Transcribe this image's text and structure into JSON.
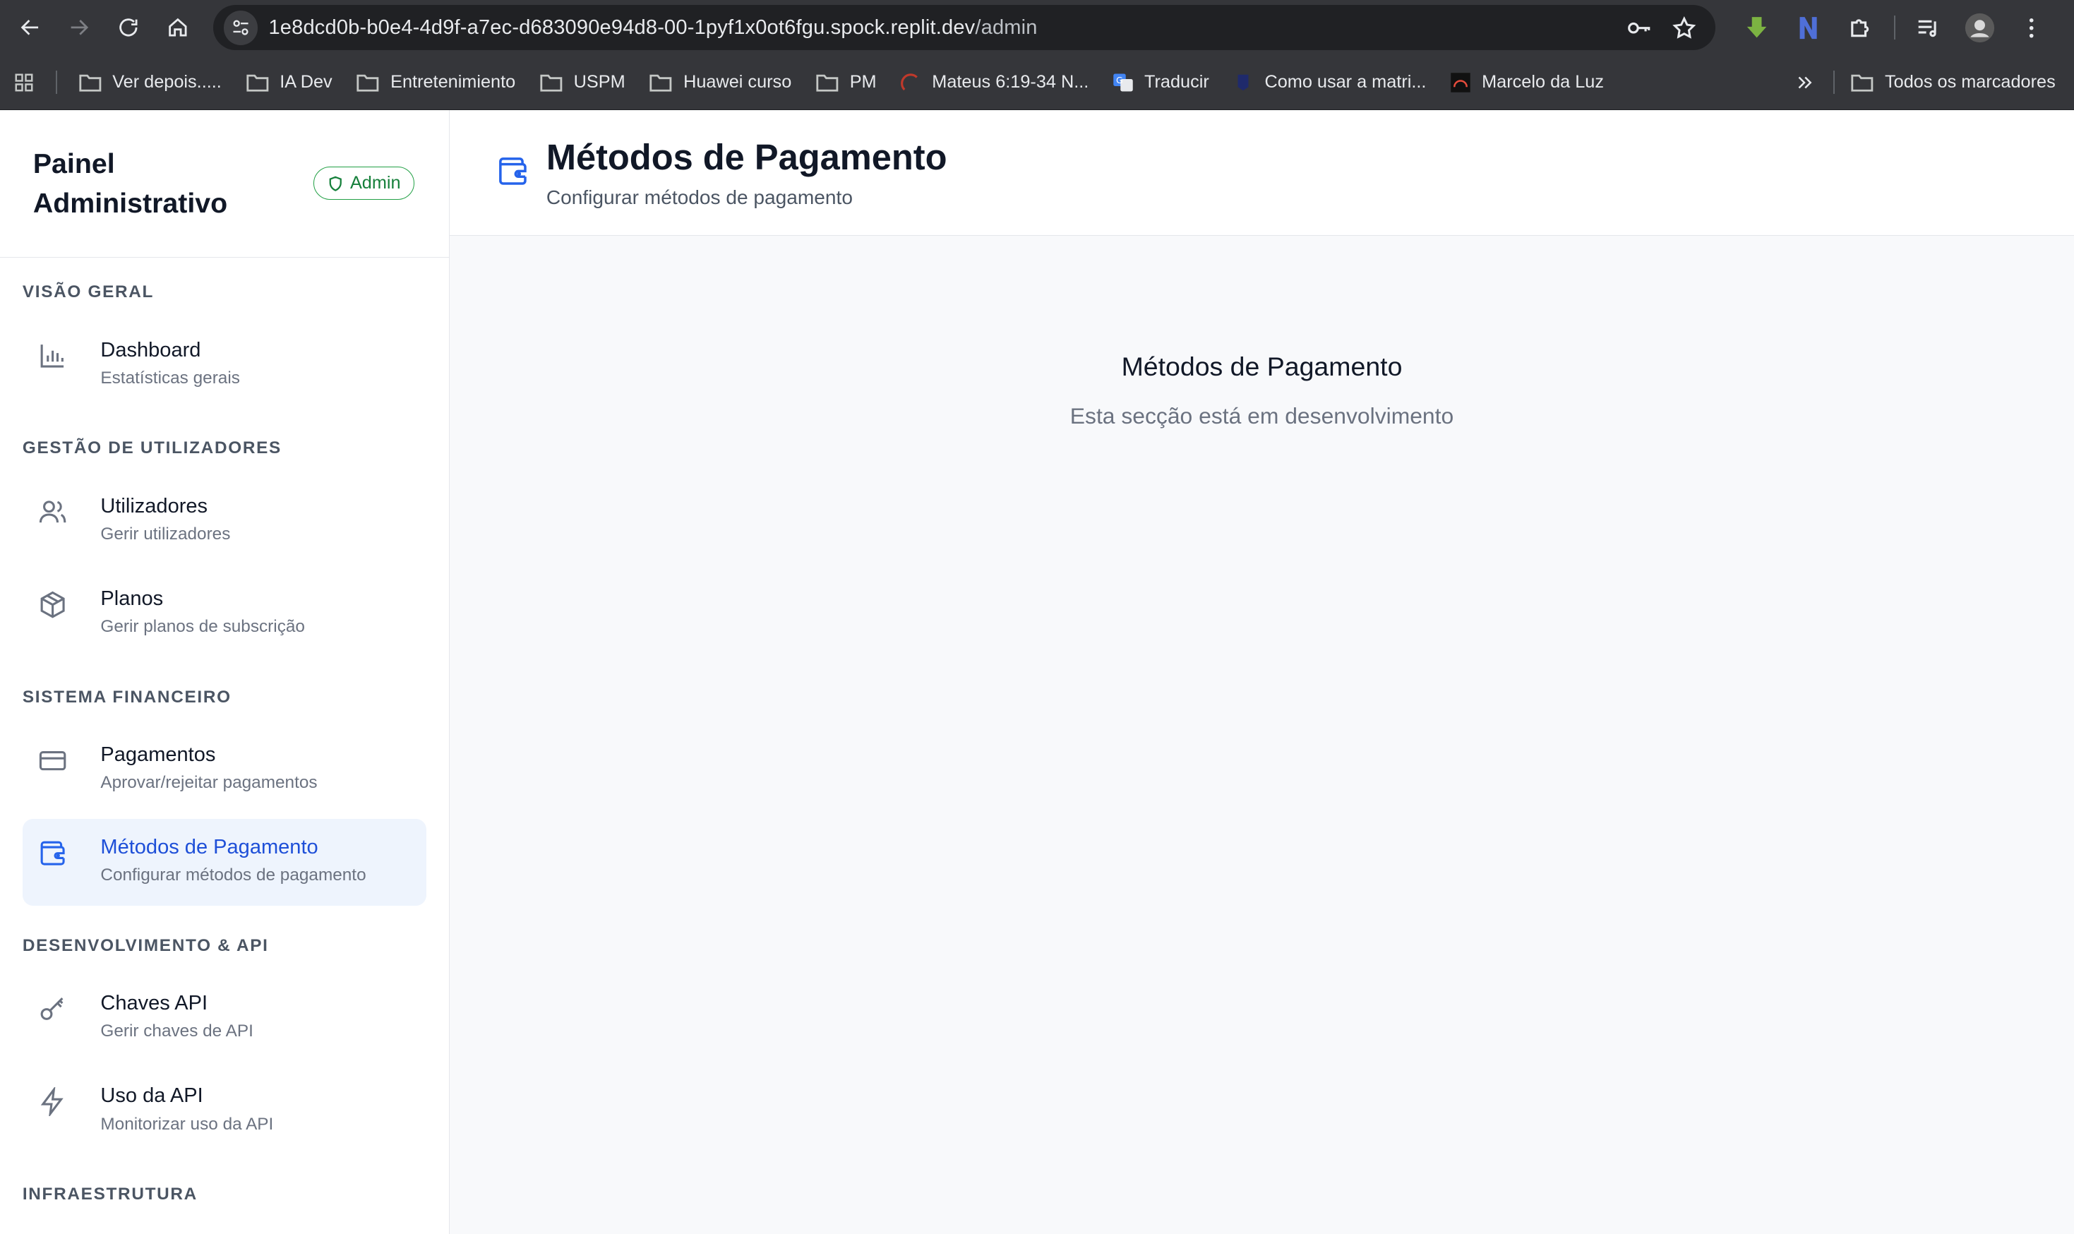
{
  "browser": {
    "url_host": "1e8dcd0b-b0e4-4d9f-a7ec-d683090e94d8-00-1pyf1x0ot6fgu.spock.replit.dev",
    "url_path": "/admin",
    "bookmarks": [
      {
        "label": "Ver depois.....",
        "icon": "folder-icon"
      },
      {
        "label": "IA Dev",
        "icon": "folder-icon"
      },
      {
        "label": "Entretenimiento",
        "icon": "folder-icon"
      },
      {
        "label": "USPM",
        "icon": "folder-icon"
      },
      {
        "label": "Huawei curso",
        "icon": "folder-icon"
      },
      {
        "label": "PM",
        "icon": "folder-icon"
      },
      {
        "label": "Mateus 6:19-34 N...",
        "icon": "site-favicon-icon"
      },
      {
        "label": "Traducir",
        "icon": "translate-favicon-icon"
      },
      {
        "label": "Como usar a matri...",
        "icon": "site-favicon-icon"
      },
      {
        "label": "Marcelo da Luz",
        "icon": "site-favicon-icon"
      }
    ],
    "all_bookmarks": "Todos os marcadores"
  },
  "sidebar": {
    "title": "Painel Administrativo",
    "badge": "Admin",
    "sections": [
      {
        "title": "VISÃO GERAL",
        "items": [
          {
            "label": "Dashboard",
            "sub": "Estatísticas gerais",
            "icon": "bar-chart-icon"
          }
        ]
      },
      {
        "title": "GESTÃO DE UTILIZADORES",
        "items": [
          {
            "label": "Utilizadores",
            "sub": "Gerir utilizadores",
            "icon": "users-icon"
          },
          {
            "label": "Planos",
            "sub": "Gerir planos de subscrição",
            "icon": "package-icon"
          }
        ]
      },
      {
        "title": "SISTEMA FINANCEIRO",
        "items": [
          {
            "label": "Pagamentos",
            "sub": "Aprovar/rejeitar pagamentos",
            "icon": "credit-card-icon"
          },
          {
            "label": "Métodos de Pagamento",
            "sub": "Configurar métodos de pagamento",
            "icon": "wallet-icon",
            "active": true
          }
        ]
      },
      {
        "title": "DESENVOLVIMENTO & API",
        "items": [
          {
            "label": "Chaves API",
            "sub": "Gerir chaves de API",
            "icon": "key-icon"
          },
          {
            "label": "Uso da API",
            "sub": "Monitorizar uso da API",
            "icon": "zap-icon"
          }
        ]
      },
      {
        "title": "INFRAESTRUTURA",
        "items": []
      }
    ]
  },
  "main": {
    "title": "Métodos de Pagamento",
    "subtitle": "Configurar métodos de pagamento",
    "placeholder_title": "Métodos de Pagamento",
    "placeholder_sub": "Esta secção está em desenvolvimento"
  },
  "colors": {
    "accent": "#2563eb",
    "active_bg": "#eef4fd",
    "badge_green": "#16803b"
  }
}
